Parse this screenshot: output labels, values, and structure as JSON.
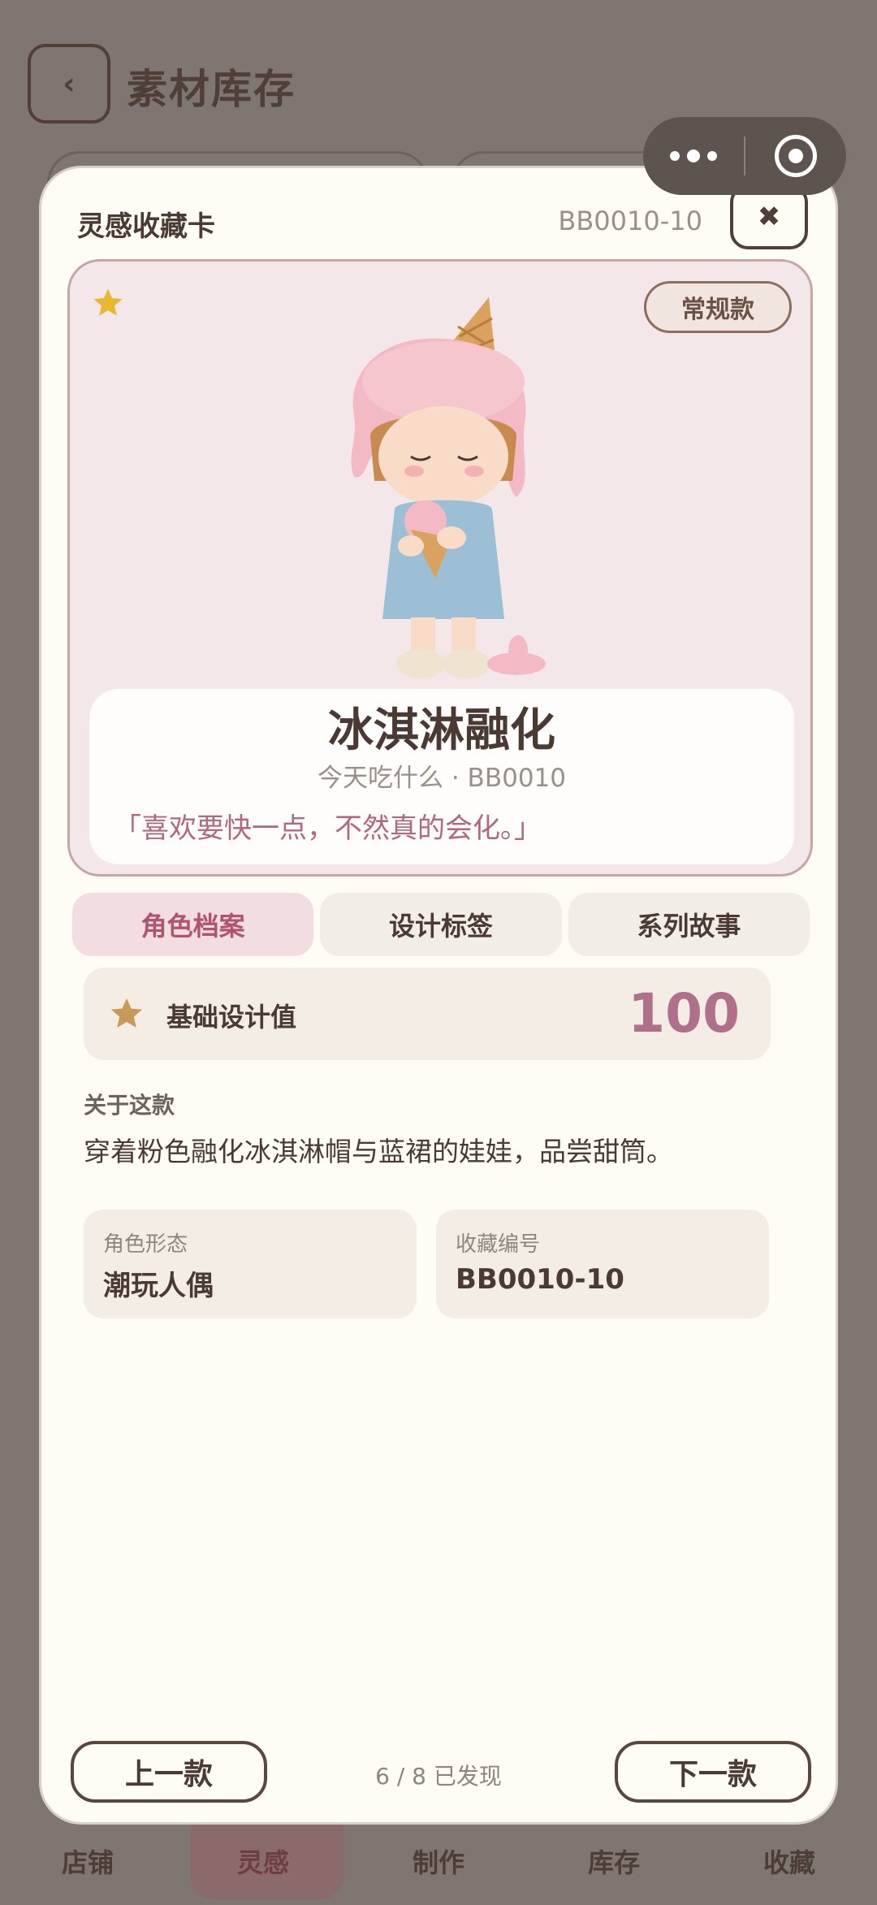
{
  "background": {
    "title": "素材库存",
    "back_icon": "chevron-left-icon"
  },
  "capsule": {
    "more_icon": "more-dots-icon",
    "close_icon": "target-circle-icon"
  },
  "tabbar": {
    "items": [
      {
        "label": "店铺",
        "active": false
      },
      {
        "label": "灵感",
        "active": true
      },
      {
        "label": "制作",
        "active": false
      },
      {
        "label": "库存",
        "active": false
      },
      {
        "label": "收藏",
        "active": false
      }
    ]
  },
  "modal": {
    "title": "灵感收藏卡",
    "code": "BB0010-10",
    "close_label": "✖",
    "rarity": "常规款",
    "favorite_icon": "star-icon",
    "name": "冰淇淋融化",
    "subtitle": "今天吃什么 · BB0010",
    "quote": "「喜欢要快一点，不然真的会化。」",
    "tabs": [
      {
        "label": "角色档案",
        "active": true
      },
      {
        "label": "设计标签",
        "active": false
      },
      {
        "label": "系列故事",
        "active": false
      }
    ],
    "score_label": "基础设计值",
    "score_value": "100",
    "about_title": "关于这款",
    "about_text": "穿着粉色融化冰淇淋帽与蓝裙的娃娃，品尝甜筒。",
    "attributes": [
      {
        "key": "角色形态",
        "value": "潮玩人偶"
      },
      {
        "key": "收藏编号",
        "value": "BB0010-10"
      }
    ],
    "prev_label": "上一款",
    "next_label": "下一款",
    "progress": "6 / 8 已发现"
  },
  "colors": {
    "accent_pink": "#b0687c",
    "star_gold": "#e8b930",
    "overlay": "#7f7571"
  }
}
